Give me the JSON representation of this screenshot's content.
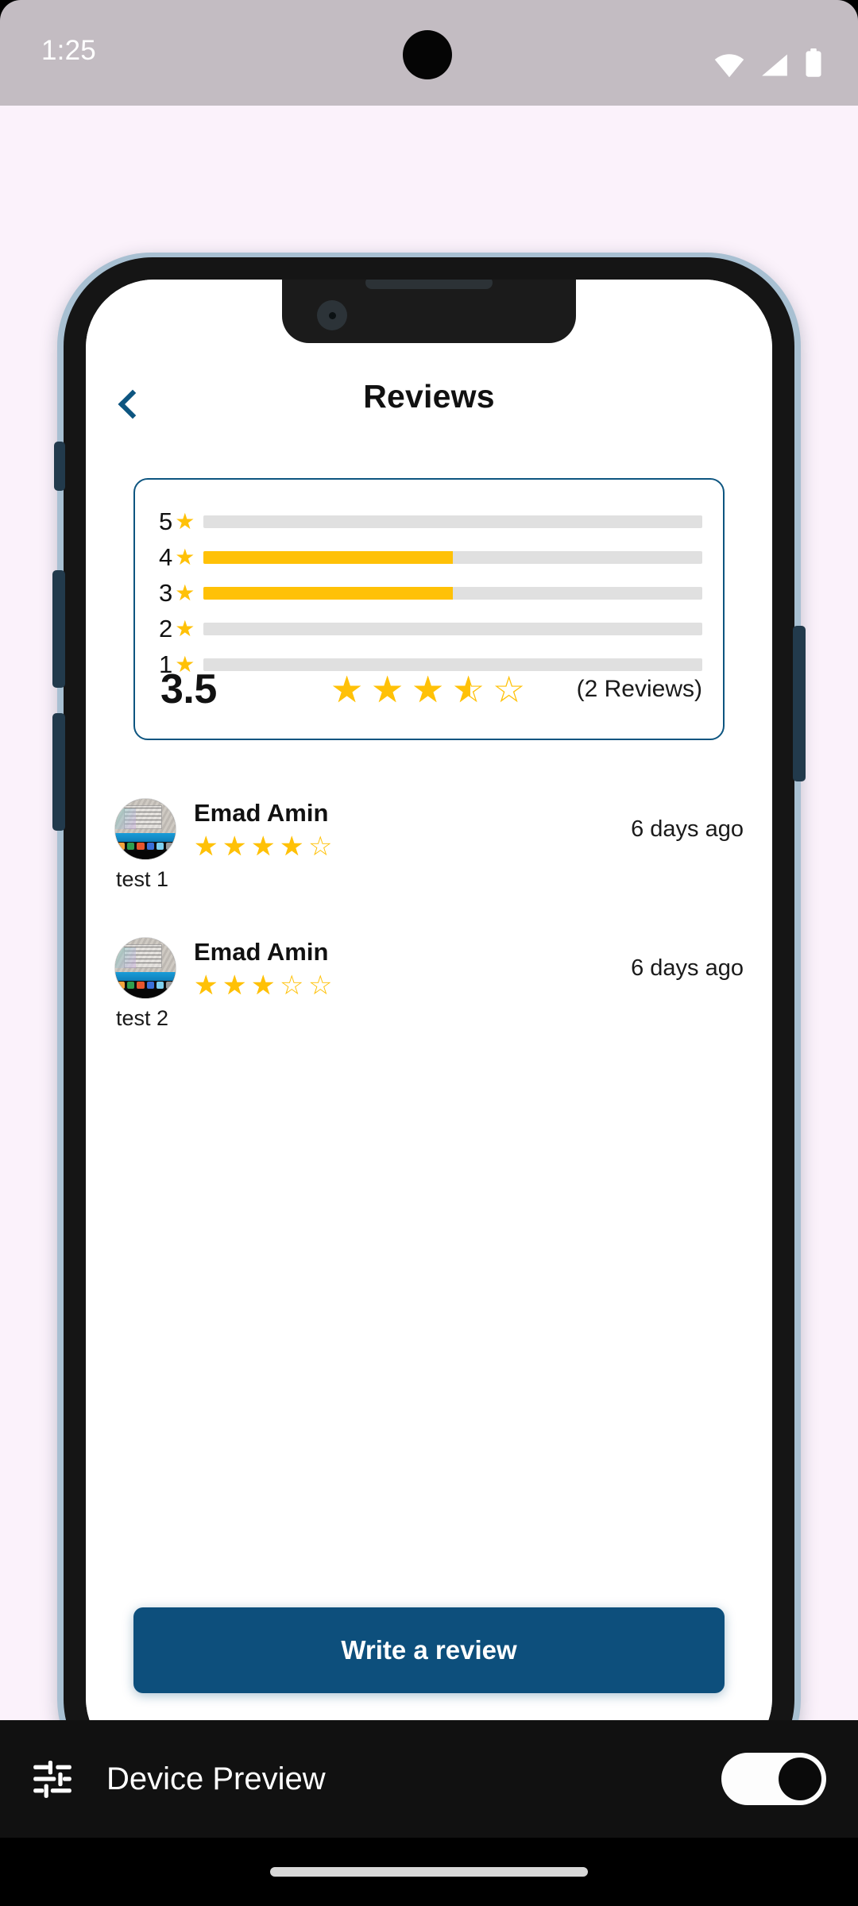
{
  "status_bar": {
    "time": "1:25",
    "icons": [
      "wifi-icon",
      "cellular-signal-icon",
      "battery-icon"
    ],
    "background": "#c3bcc2"
  },
  "app": {
    "appbar": {
      "back_icon": "chevron-left-icon",
      "title": "Reviews"
    },
    "rating_summary": {
      "average": "3.5",
      "average_stars": 3.5,
      "review_count_label": "(2 Reviews)",
      "bar_star_glyph": "★",
      "distribution": [
        {
          "stars": "5",
          "percent": 0
        },
        {
          "stars": "4",
          "percent": 50
        },
        {
          "stars": "3",
          "percent": 50
        },
        {
          "stars": "2",
          "percent": 0
        },
        {
          "stars": "1",
          "percent": 0
        }
      ]
    },
    "reviews": [
      {
        "name": "Emad Amin",
        "rating": 4,
        "time": "6 days ago",
        "text": "test 1",
        "avatar": "desktop-screenshot-avatar"
      },
      {
        "name": "Emad Amin",
        "rating": 3,
        "time": "6 days ago",
        "text": "test 2",
        "avatar": "desktop-screenshot-avatar"
      }
    ],
    "write_review_label": "Write a review"
  },
  "bottom_bar": {
    "icon": "tune-sliders-icon",
    "label": "Device Preview",
    "toggle_state": "on"
  },
  "colors": {
    "accent_blue": "#0d5580",
    "button_blue": "#0d4f7c",
    "star_amber": "#ffc107",
    "track_gray": "#e0e0e0",
    "stage_background": "#fbf2fb",
    "device_bezel": "#a8c0d2",
    "bottom_bar_background": "#111111"
  }
}
